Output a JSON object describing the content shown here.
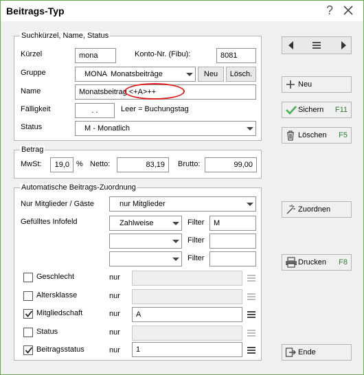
{
  "window": {
    "title": "Beitrags-Typ",
    "help_icon": "help-icon",
    "close_icon": "close-icon"
  },
  "group1": {
    "title": "Suchkürzel, Name, Status",
    "kuerzel_label": "Kürzel",
    "kuerzel_value": "mona",
    "konto_label": "Konto-Nr. (Fibu):",
    "konto_value": "8081",
    "gruppe_label": "Gruppe",
    "gruppe_code": "MONA",
    "gruppe_value": "Monatsbeiträge",
    "neu_label": "Neu",
    "loesch_label": "Lösch.",
    "name_label": "Name",
    "name_value": "Monatsbeitrag <+A>++",
    "faelligkeit_label": "Fälligkeit",
    "faelligkeit_value": ". .",
    "faelligkeit_hint": "Leer = Buchungstag",
    "status_label": "Status",
    "status_value": "M - Monatlich"
  },
  "group2": {
    "title": "Betrag",
    "mwst_label": "MwSt:",
    "mwst_value": "19,0",
    "percent": "%",
    "netto_label": "Netto:",
    "netto_value": "83,19",
    "brutto_label": "Brutto:",
    "brutto_value": "99,00"
  },
  "group3": {
    "title": "Automatische Beitrags-Zuordnung",
    "nur_mitglieder_label": "Nur Mitglieder / Gäste",
    "nur_mitglieder_value": "nur Mitglieder",
    "infofeld_label": "Gefülltes Infofeld",
    "infofeld_rows": [
      {
        "value": "Zahlweise",
        "filter_label": "Filter",
        "filter_value": "M"
      },
      {
        "value": "",
        "filter_label": "Filter",
        "filter_value": ""
      },
      {
        "value": "",
        "filter_label": "Filter",
        "filter_value": ""
      }
    ],
    "checkbox_rows": [
      {
        "label": "Geschlecht",
        "checked": false,
        "nur": "nur",
        "value": "",
        "enabled": false
      },
      {
        "label": "Altersklasse",
        "checked": false,
        "nur": "nur",
        "value": "",
        "enabled": false
      },
      {
        "label": "Mitgliedschaft",
        "checked": true,
        "nur": "nur",
        "value": "A",
        "enabled": true
      },
      {
        "label": "Status",
        "checked": false,
        "nur": "nur",
        "value": "",
        "enabled": false
      },
      {
        "label": "Beitragsstatus",
        "checked": true,
        "nur": "nur",
        "value": "1",
        "enabled": true
      }
    ]
  },
  "sidebar": {
    "nav_prev_icon": "prev-icon",
    "nav_menu_icon": "menu-icon",
    "nav_next_icon": "next-icon",
    "neu_label": "Neu",
    "sichern_label": "Sichern",
    "sichern_shortcut": "F11",
    "loeschen_label": "Löschen",
    "loeschen_shortcut": "F5",
    "zuordnen_label": "Zuordnen",
    "drucken_label": "Drucken",
    "drucken_shortcut": "F8",
    "ende_label": "Ende"
  },
  "colors": {
    "accent_green": "#6aa84f",
    "shortcut_green": "#2e7d32",
    "annotation_red": "#e02020"
  }
}
